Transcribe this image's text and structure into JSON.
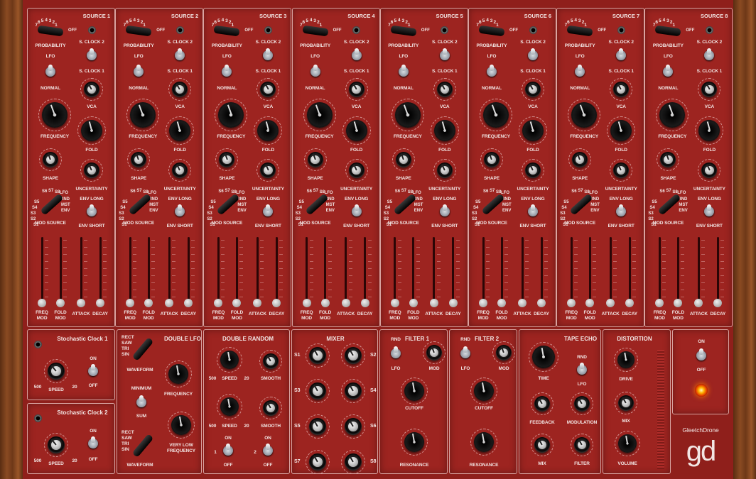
{
  "app": {
    "brand": "GleetchDrone",
    "logo": "gd"
  },
  "sources": [
    {
      "title": "SOURCE 1"
    },
    {
      "title": "SOURCE 2"
    },
    {
      "title": "SOURCE 3"
    },
    {
      "title": "SOURCE 4"
    },
    {
      "title": "SOURCE 5"
    },
    {
      "title": "SOURCE 6"
    },
    {
      "title": "SOURCE 7"
    },
    {
      "title": "SOURCE 8"
    }
  ],
  "source_labels": {
    "prob_scale": [
      "7",
      "6",
      "5",
      "4",
      "3",
      "2",
      "1"
    ],
    "prob_off": "OFF",
    "probability": "PROBABILITY",
    "sclock2": "S. CLOCK 2",
    "lfo": "LFO",
    "sclock1": "S. CLOCK 1",
    "normal": "NORMAL",
    "vca": "VCA",
    "frequency": "FREQUENCY",
    "fold": "FOLD",
    "shape": "SHAPE",
    "uncertainty": "UNCERTAINTY",
    "mod_left": [
      "S5",
      "S4",
      "S3",
      "S2",
      "S1"
    ],
    "mod_top": [
      "S6",
      "S7",
      "S8"
    ],
    "mod_right": [
      "LFO",
      "RND",
      "MST",
      "ENV"
    ],
    "mod_source": "MOD SOURCE",
    "env_long": "ENV LONG",
    "env_short": "ENV SHORT",
    "freq_mod": [
      "FREQ",
      "MOD"
    ],
    "fold_mod": [
      "FOLD",
      "MOD"
    ],
    "attack": "ATTACK",
    "decay": "DECAY"
  },
  "clock1": {
    "title": "Stochastic Clock 1",
    "min": "500",
    "speed": "SPEED",
    "max": "20",
    "on": "ON",
    "off": "OFF"
  },
  "clock2": {
    "title": "Stochastic Clock 2",
    "min": "500",
    "speed": "SPEED",
    "max": "20",
    "on": "ON",
    "off": "OFF"
  },
  "double_lfo": {
    "title": "DOUBLE LFO",
    "waves": [
      "RECT",
      "SAW",
      "TRI",
      "SIN"
    ],
    "waveform": "WAVEFORM",
    "frequency": "FREQUENCY",
    "minimum": "MINIMUM",
    "sum": "SUM",
    "vlf": [
      "VERY LOW",
      "FREQUENCY"
    ]
  },
  "double_random": {
    "title": "DOUBLE RANDOM",
    "min": "500",
    "speed": "SPEED",
    "max": "20",
    "smooth": "SMOOTH",
    "on": "ON",
    "off": "OFF",
    "n1": "1",
    "n2": "2"
  },
  "mixer": {
    "title": "MIXER",
    "left": [
      "S1",
      "S3",
      "S5",
      "S7"
    ],
    "right": [
      "S2",
      "S4",
      "S6",
      "S8"
    ]
  },
  "filter1": {
    "title": "FILTER 1",
    "rnd": "RND",
    "lfo": "LFO",
    "mod": "MOD",
    "cutoff": "CUTOFF",
    "resonance": "RESONANCE"
  },
  "filter2": {
    "title": "FILTER 2",
    "rnd": "RND",
    "lfo": "LFO",
    "mod": "MOD",
    "cutoff": "CUTOFF",
    "resonance": "RESONANCE"
  },
  "tape_echo": {
    "title": "TAPE ECHO",
    "time": "TIME",
    "rnd": "RND",
    "lfo": "LFO",
    "feedback": "FEEDBACK",
    "modulation": "MODULATION",
    "mix": "MIX",
    "filter": "FILTER"
  },
  "distortion": {
    "title": "DISTORTION",
    "drive": "DRIVE",
    "mix": "MIX",
    "volume": "VOLUME"
  },
  "power": {
    "on": "ON",
    "off": "OFF"
  }
}
